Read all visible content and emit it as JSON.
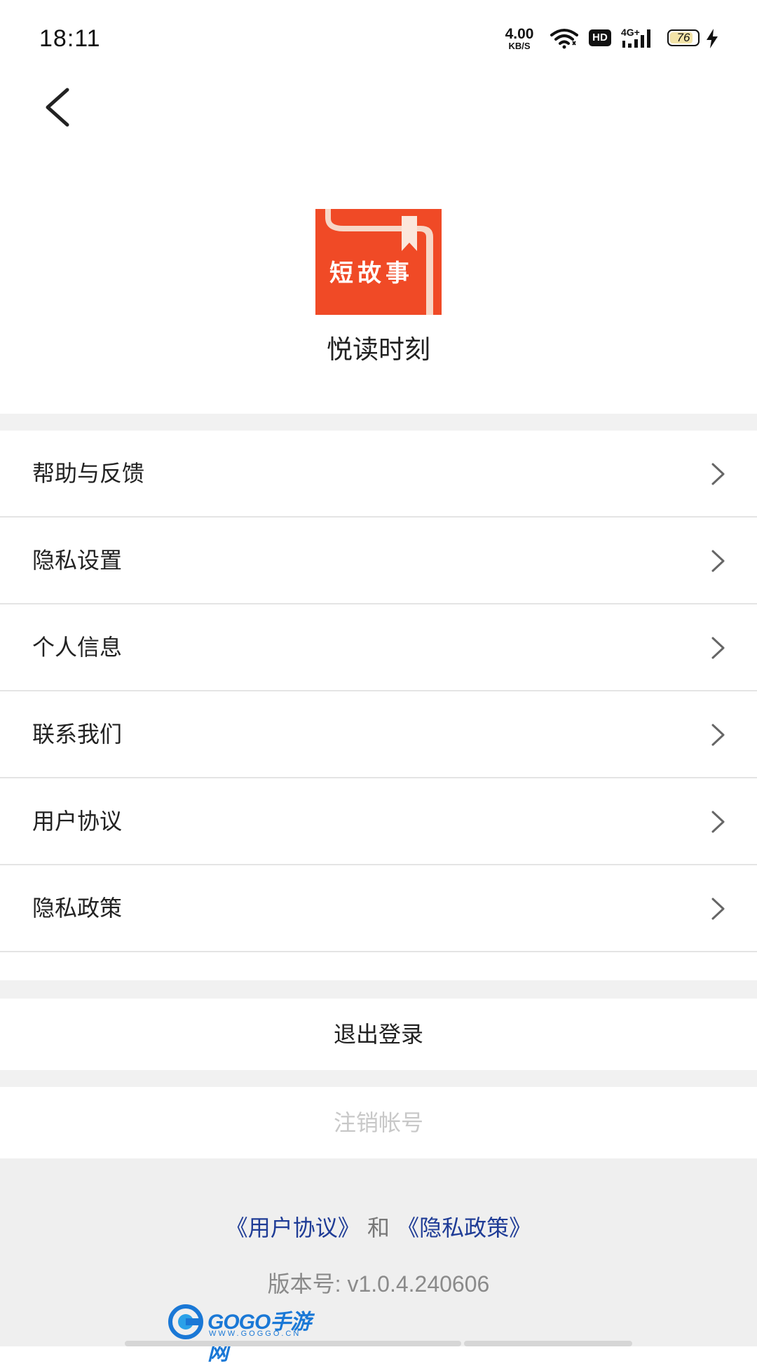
{
  "status_bar": {
    "time": "18:11",
    "net_speed_value": "4.00",
    "net_speed_unit": "KB/S",
    "hd_badge": "HD",
    "network_type": "4G+",
    "battery": "76",
    "icons": [
      "wifi-icon",
      "hd-icon",
      "signal-icon",
      "battery-icon",
      "charging-icon"
    ]
  },
  "app": {
    "logo_text": "短故事",
    "name": "悦读时刻",
    "logo_color": "#f04a26"
  },
  "menu": [
    {
      "label": "帮助与反馈"
    },
    {
      "label": "隐私设置"
    },
    {
      "label": "个人信息"
    },
    {
      "label": "联系我们"
    },
    {
      "label": "用户协议"
    },
    {
      "label": "隐私政策"
    }
  ],
  "actions": {
    "logout_label": "退出登录",
    "delete_account_label": "注销帐号"
  },
  "footer": {
    "user_agreement_link": "《用户协议》",
    "and_text": "和",
    "privacy_policy_link": "《隐私政策》",
    "version": "版本号: v1.0.4.240606",
    "link_color": "#1f3c96"
  },
  "watermark": {
    "text": "GOGO手游网",
    "url_text": "WWW.GOGGO.CN"
  }
}
